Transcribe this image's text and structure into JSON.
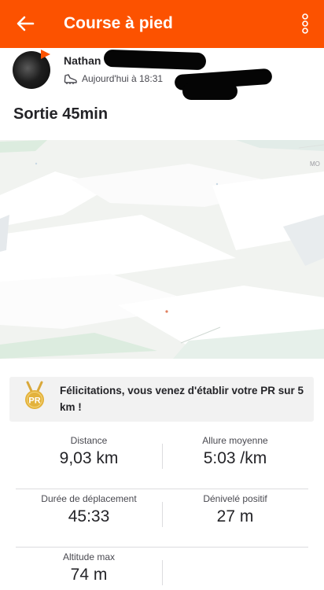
{
  "header": {
    "title": "Course à pied",
    "back_icon": "arrow-left-icon",
    "more_icon": "more-vertical-icon",
    "background_color": "#fc5200"
  },
  "athlete": {
    "name": "Nathan",
    "activity_type_icon": "running-shoe-icon",
    "date_text": "Aujourd'hui à 18:31"
  },
  "activity": {
    "title": "Sortie 45min"
  },
  "pr_banner": {
    "icon": "medal-icon",
    "medal_text": "PR",
    "message": "Félicitations, vous venez d'établir votre PR sur 5 km !"
  },
  "stats": [
    {
      "label": "Distance",
      "value": "9,03 km"
    },
    {
      "label": "Allure moyenne",
      "value": "5:03 /km"
    },
    {
      "label": "Durée de déplacement",
      "value": "45:33"
    },
    {
      "label": "Dénivelé positif",
      "value": "27 m"
    },
    {
      "label": "Altitude max",
      "value": "74 m"
    }
  ],
  "map": {
    "corner_label": "MO"
  }
}
